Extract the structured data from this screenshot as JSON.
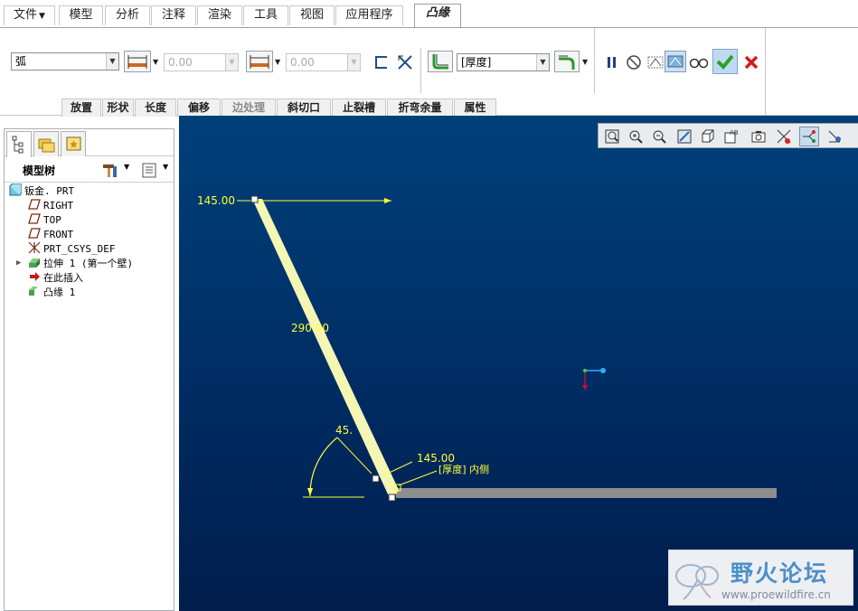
{
  "menu": {
    "tabs": [
      {
        "label": "文件"
      },
      {
        "label": "模型"
      },
      {
        "label": "分析"
      },
      {
        "label": "注释"
      },
      {
        "label": "渲染"
      },
      {
        "label": "工具"
      },
      {
        "label": "视图"
      },
      {
        "label": "应用程序"
      },
      {
        "label": "凸缘"
      }
    ],
    "active_tab": "凸缘"
  },
  "ribbon": {
    "shape_select": {
      "value": "弧"
    },
    "length1_value": "0.00",
    "length2_value": "0.00",
    "thickness_select": {
      "value": "[厚度]"
    },
    "subtabs": [
      "放置",
      "形状",
      "长度",
      "偏移",
      "边处理",
      "斜切口",
      "止裂槽",
      "折弯余量",
      "属性"
    ],
    "disabled_subtab": "边处理"
  },
  "model_tree": {
    "title": "模型树",
    "items": [
      {
        "label": "钣金. PRT",
        "icon": "part-icon"
      },
      {
        "label": "RIGHT",
        "icon": "datum-plane-icon"
      },
      {
        "label": "TOP",
        "icon": "datum-plane-icon"
      },
      {
        "label": "FRONT",
        "icon": "datum-plane-icon"
      },
      {
        "label": "PRT_CSYS_DEF",
        "icon": "csys-icon"
      },
      {
        "label": "拉伸 1 (第一个壁)",
        "icon": "extrude-icon"
      },
      {
        "label": "在此插入",
        "icon": "insert-here-icon"
      },
      {
        "label": "凸缘 1",
        "icon": "flange-icon"
      }
    ]
  },
  "viewport": {
    "dimensions": {
      "top_length": "145.00",
      "diag_length": "290.00",
      "angle": "45.",
      "corner_length": "145.00",
      "thickness_note": "[厚度] 内侧"
    }
  },
  "watermark": {
    "title": "野火论坛",
    "url": "www.proewildfire.cn"
  },
  "colors": {
    "viewport_top": "#00407a",
    "viewport_bottom": "#001d4c",
    "flange": "#f5f5b4",
    "dimension": "#ffff33",
    "accept": "#2aa12a",
    "cancel": "#d21c1c"
  }
}
